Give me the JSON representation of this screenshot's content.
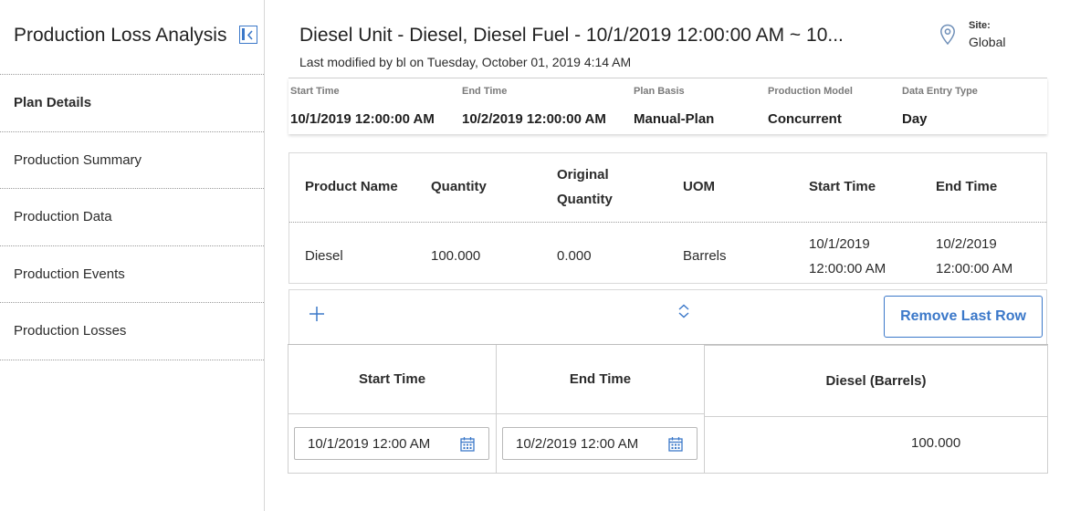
{
  "sidebar": {
    "title": "Production Loss Analysis",
    "items": [
      {
        "label": "Plan Details"
      },
      {
        "label": "Production Summary"
      },
      {
        "label": "Production Data"
      },
      {
        "label": "Production Events"
      },
      {
        "label": "Production Losses"
      }
    ]
  },
  "header": {
    "title": "Diesel Unit - Diesel, Diesel Fuel - 10/1/2019 12:00:00 AM ~ 10...",
    "subtitle": "Last modified by bl on Tuesday, October 01, 2019 4:14 AM",
    "site_label": "Site:",
    "site_value": "Global"
  },
  "details": [
    {
      "label": "Start Time",
      "value": "10/1/2019 12:00:00 AM"
    },
    {
      "label": "End Time",
      "value": "10/2/2019 12:00:00 AM"
    },
    {
      "label": "Plan Basis",
      "value": "Manual-Plan"
    },
    {
      "label": "Production Model",
      "value": "Concurrent"
    },
    {
      "label": "Data Entry Type",
      "value": "Day"
    }
  ],
  "product_table": {
    "columns": [
      "Product Name",
      "Quantity",
      "Original",
      "Quantity",
      "UOM",
      "Start Time",
      "End Time"
    ],
    "row": {
      "product": "Diesel",
      "quantity": "100.000",
      "original_quantity": "0.000",
      "uom": "Barrels",
      "start_date": "10/1/2019",
      "start_time": "12:00:00 AM",
      "end_date": "10/2/2019",
      "end_time": "12:00:00 AM"
    }
  },
  "toolbar": {
    "add_icon": "plus-icon",
    "sort_icon": "sort-icon",
    "remove_label": "Remove Last Row"
  },
  "entry_grid": {
    "columns": [
      "Start Time",
      "End Time",
      "Diesel (Barrels)"
    ],
    "row": {
      "start": "10/1/2019 12:00 AM",
      "end": "10/2/2019 12:00 AM",
      "value": "100.000"
    }
  },
  "colors": {
    "accent": "#3b78c9",
    "border": "#d9d9d9",
    "label_gray": "#7a7a7a"
  }
}
